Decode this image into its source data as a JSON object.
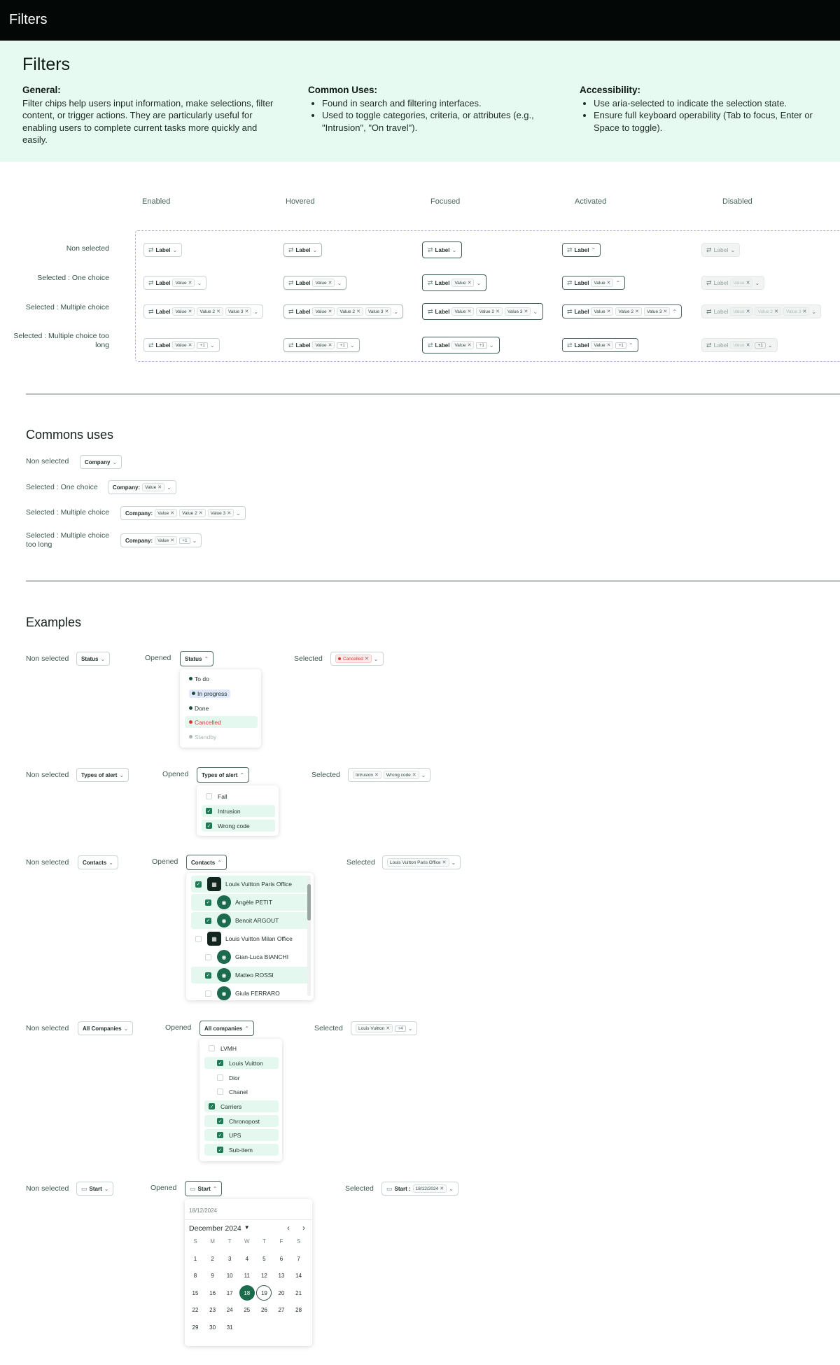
{
  "header": {
    "title": "Filters"
  },
  "intro": {
    "title": "Filters",
    "general": {
      "heading": "General:",
      "text": "Filter chips help users input information, make selections, filter content, or trigger actions. They are particularly useful for enabling users to complete current tasks more quickly and easily."
    },
    "common": {
      "heading": "Common Uses:",
      "items": [
        "Found in search and filtering interfaces.",
        "Used to toggle categories, criteria, or attributes (e.g., \"Intrusion\", \"On travel\")."
      ]
    },
    "access": {
      "heading": "Accessibility:",
      "items": [
        "Use aria-selected to indicate the selection state.",
        "Ensure full keyboard operability (Tab to focus, Enter or Space to toggle)."
      ]
    }
  },
  "states": {
    "columns": [
      "Enabled",
      "Hovered",
      "Focused",
      "Activated",
      "Disabled"
    ],
    "rows": [
      "Non selected",
      "Selected : One choice",
      "Selected : Multiple choice",
      "Selected : Multiple choice too long"
    ],
    "label": "Label",
    "value1": "Value",
    "value2": "Value 2",
    "value3": "Value 3",
    "more": "+1"
  },
  "commons": {
    "title": "Commons uses",
    "rows": [
      "Non selected",
      "Selected : One choice",
      "Selected : Multiple choice",
      "Selected : Multiple choice too long"
    ],
    "chip_label": "Company",
    "prefix": "Company:",
    "value1": "Value",
    "value2": "Value 2",
    "value3": "Value 3",
    "more": "+1"
  },
  "examples": {
    "title": "Examples",
    "lbl_non": "Non selected",
    "lbl_open": "Opened",
    "lbl_sel": "Selected",
    "status": {
      "chip": "Status",
      "selected": "Cancelled",
      "options": [
        {
          "label": "To do",
          "color": "#1b4d3a"
        },
        {
          "label": "In progress",
          "color": "#1b4d3a"
        },
        {
          "label": "Done",
          "color": "#1b4d3a"
        },
        {
          "label": "Cancelled",
          "color": "#d83a3a"
        },
        {
          "label": "Standby",
          "color": "#9fb3ab"
        }
      ]
    },
    "alerts": {
      "chip": "Types of alert",
      "options": [
        "Fall",
        "Intrusion",
        "Wrong code"
      ],
      "selected": [
        "Intrusion",
        "Wrong code"
      ]
    },
    "contacts": {
      "chip": "Contacts",
      "selected": "Louis Vuitton Paris Office",
      "options": [
        "Louis Vuitton Paris Office",
        "Angèle PETIT",
        "Benoit ARGOUT",
        "Louis Vuitton Milan Office",
        "Gian-Luca BIANCHI",
        "Matteo ROSSI",
        "Giula FERRARO"
      ]
    },
    "companies": {
      "chip_non": "All Companies",
      "chip_open": "All companies",
      "selected": "Louis Vuitton",
      "more": "+4",
      "options": [
        "LVMH",
        "Louis Vuitton",
        "Dior",
        "Chanel",
        "Carriers",
        "Chronopost",
        "UPS",
        "Sub-item"
      ]
    },
    "date": {
      "chip": "Start",
      "selected_prefix": "Start :",
      "selected_value": "18/12/2024",
      "input": "18/12/2024",
      "month": "December 2024",
      "weekdays": [
        "S",
        "M",
        "T",
        "W",
        "T",
        "F",
        "S"
      ],
      "days": [
        "1",
        "2",
        "3",
        "4",
        "5",
        "6",
        "7",
        "8",
        "9",
        "10",
        "11",
        "12",
        "13",
        "14",
        "15",
        "16",
        "17",
        "18",
        "19",
        "20",
        "21",
        "22",
        "23",
        "24",
        "25",
        "26",
        "27",
        "28",
        "29",
        "30",
        "31"
      ],
      "today": "18",
      "highlight": "19"
    }
  },
  "colors": {
    "accent": "#1e7a55",
    "mint": "#e6faf2",
    "danger": "#d83a3a"
  }
}
